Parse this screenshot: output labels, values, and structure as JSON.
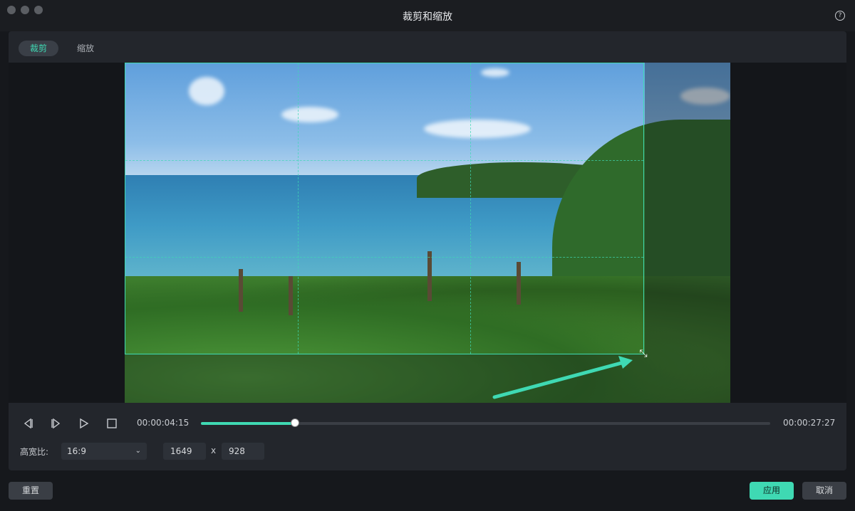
{
  "window": {
    "title": "裁剪和缩放"
  },
  "tabs": [
    {
      "label": "裁剪",
      "active": true
    },
    {
      "label": "缩放",
      "active": false
    }
  ],
  "player": {
    "current_time": "00:00:04:15",
    "total_time": "00:00:27:27",
    "progress_fraction": 0.165
  },
  "aspect": {
    "label": "高宽比:",
    "value": "16:9",
    "width": "1649",
    "x_separator": "x",
    "height": "928"
  },
  "buttons": {
    "reset": "重置",
    "apply": "应用",
    "cancel": "取消"
  },
  "colors": {
    "accent": "#3fd9b3",
    "background": "#16181c",
    "panel": "#23262c"
  },
  "icons": {
    "help": "help-circle-icon",
    "resize": "resize-diagonal-icon",
    "prev_frame": "previous-frame-icon",
    "next_frame": "next-frame-icon",
    "play": "play-icon",
    "stop": "stop-icon",
    "chevron": "chevron-down-icon"
  }
}
